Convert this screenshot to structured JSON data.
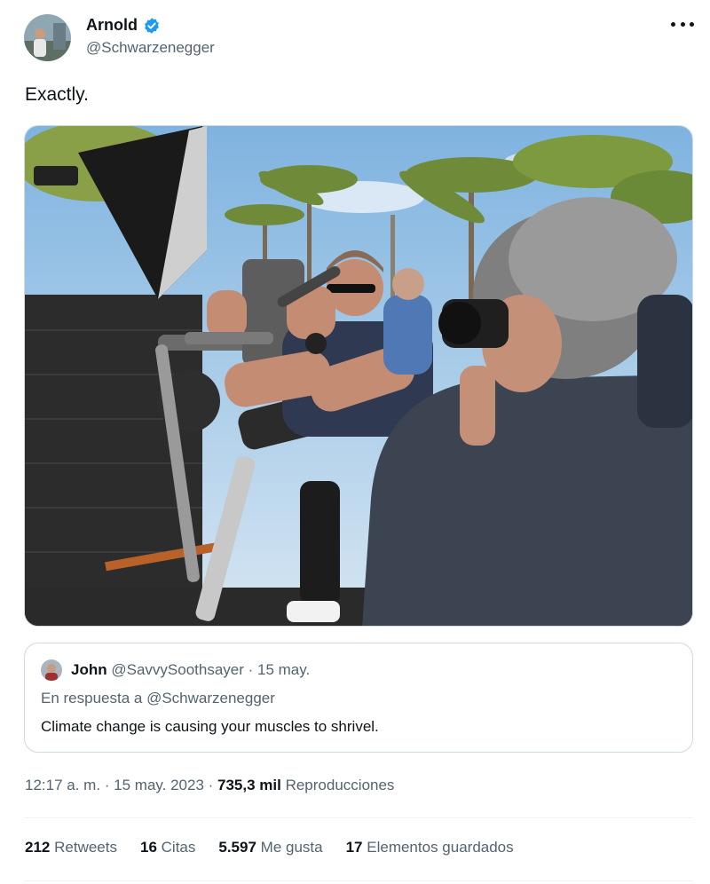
{
  "author": {
    "display_name": "Arnold",
    "handle": "@Schwarzenegger",
    "verified_icon": "verified-badge-icon",
    "avatar_icon": "avatar"
  },
  "tweet": {
    "text": "Exactly.",
    "photo_alt_icon": "tweet-photo"
  },
  "quote": {
    "name": "John",
    "meta": "@SavvySoothsayer · 15 may.",
    "reply_to": "En respuesta a @Schwarzenegger",
    "text": "Climate change is causing your muscles to shrivel."
  },
  "meta": {
    "time": "12:17 a. m. · 15 may. 2023 · ",
    "views_count": "735,3 mil",
    "views_label": "Reproducciones"
  },
  "stats": {
    "retweets_count": "212",
    "retweets_label": "Retweets",
    "quotes_count": "16",
    "quotes_label": "Citas",
    "likes_count": "5.597",
    "likes_label": "Me gusta",
    "bookmarks_count": "17",
    "bookmarks_label": "Elementos guardados"
  },
  "colors": {
    "text": "#0f1419",
    "secondary": "#536471",
    "border": "#cfd9de",
    "verified": "#1d9bf0"
  }
}
